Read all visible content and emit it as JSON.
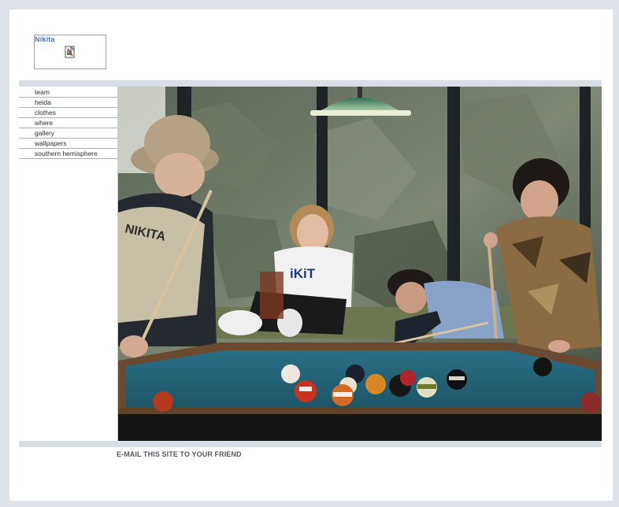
{
  "logo": {
    "text": "Nikita",
    "icon": "broken-image-icon"
  },
  "nav": {
    "items": [
      {
        "label": "team"
      },
      {
        "label": "heida"
      },
      {
        "label": "clothes"
      },
      {
        "label": "where"
      },
      {
        "label": "gallery"
      },
      {
        "label": "wallpapers"
      },
      {
        "label": "southern hemisphere"
      }
    ]
  },
  "photo": {
    "subject": "group-at-pool-table",
    "shirt_text": "iKiT",
    "hoodie_text": "NIKITA"
  },
  "footer": {
    "email_link": "E-MAIL THIS SITE TO YOUR FRIEND"
  },
  "colors": {
    "page_bg": "#dde3e9",
    "band": "#d7dee5",
    "logo_text": "#4a79b6"
  }
}
